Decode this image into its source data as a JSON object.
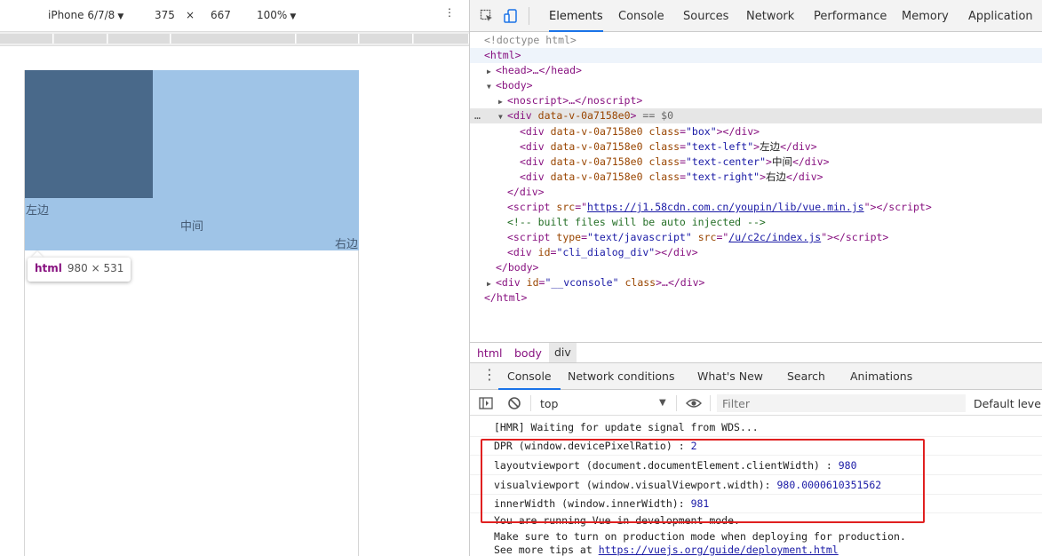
{
  "device_toolbar": {
    "device": "iPhone 6/7/8",
    "width": "375",
    "times": "×",
    "height": "667",
    "zoom": "100%",
    "more": "⋮"
  },
  "page": {
    "text_left": "左边",
    "text_center": "中间",
    "text_right": "右边"
  },
  "tooltip": {
    "tag": "html",
    "dims": "980 × 531"
  },
  "devtools": {
    "tabs": [
      "Elements",
      "Console",
      "Sources",
      "Network",
      "Performance",
      "Memory",
      "Application"
    ],
    "elements": {
      "doctype": "<!doctype html>",
      "html_open": "<html>",
      "head": "<head>…</head>",
      "body_open": "<body>",
      "noscript": "<noscript>…</noscript>",
      "div_tag": "div",
      "div_attr": "data-v-0a7158e0",
      "eq0": "== $0",
      "dots": "…",
      "child_attr": "data-v-0a7158e0",
      "class_attr": "class",
      "box_class": "\"box\"",
      "left_class": "\"text-left\"",
      "left_text": "左边",
      "center_class": "\"text-center\"",
      "center_text": "中间",
      "right_class": "\"text-right\"",
      "right_text": "右边",
      "div_close": "</div>",
      "script_src_attr": "src",
      "script_src": "https://j1.58cdn.com.cn/youpin/lib/vue.min.js",
      "comment": "<!-- built files will be auto injected -->",
      "script2_type_attr": "type",
      "script2_type": "\"text/javascript\"",
      "script2_src": "/u/c2c/index.js",
      "dialog_id_attr": "id",
      "dialog_id": "\"cli_dialog_div\"",
      "body_close": "</body>",
      "vconsole_id": "\"__vconsole\"",
      "vconsole_class_attr": "class",
      "html_close": "</html>"
    },
    "breadcrumbs": [
      "html",
      "body",
      "div"
    ],
    "drawer_tabs": [
      "Console",
      "Network conditions",
      "What's New",
      "Search",
      "Animations"
    ],
    "console_toolbar": {
      "context": "top",
      "filter_placeholder": "Filter",
      "levels": "Default levels"
    },
    "console_lines": [
      {
        "text": "[HMR] Waiting for update signal from WDS..."
      },
      {
        "label": "DPR (window.devicePixelRatio) :  ",
        "value": "2"
      },
      {
        "label": "layoutviewport  (document.documentElement.clientWidth) :  ",
        "value": "980"
      },
      {
        "label": "visualviewport  (window.visualViewport.width):  ",
        "value": "980.0000610351562"
      },
      {
        "label": "innerWidth  (window.innerWidth):  ",
        "value": "981"
      },
      {
        "text": "You are running Vue in development mode."
      },
      {
        "text": "Make sure to turn on production mode when deploying for production."
      },
      {
        "text": "See more tips at ",
        "link": "https://vuejs.org/guide/deployment.html"
      }
    ]
  },
  "colors": {
    "highlight_bg": "#9fc4e7",
    "box": "#49698a",
    "accent": "#1a73e8",
    "annotation_red": "#e02020"
  }
}
